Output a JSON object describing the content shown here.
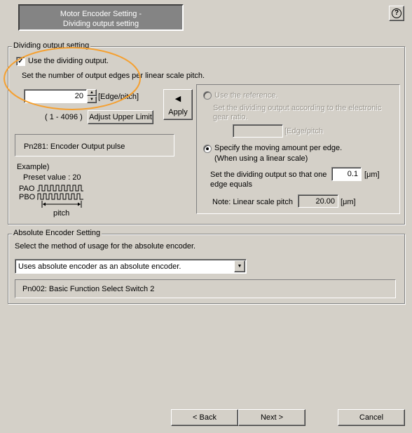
{
  "header": {
    "title_line1": "Motor Encoder Setting -",
    "title_line2": "Dividing output setting",
    "help_label": "?"
  },
  "dividing": {
    "group_label": "Dividing output setting",
    "use_checkbox_label": "Use the dividing output.",
    "use_checked": true,
    "instruction": "Set the number of output edges per linear scale pitch.",
    "edge_value": "20",
    "edge_unit": "[Edge/pitch]",
    "range": "( 1 - 4096 )",
    "adjust_button": "Adjust Upper Limit",
    "apply_button": "Apply",
    "param_label": "Pn281: Encoder Output pulse",
    "example_title": "Example)",
    "preset_value": "Preset value : 20",
    "pao_label": "PAO",
    "pbo_label": "PBO",
    "pitch_label": "pitch",
    "reference_radio_label": "Use the reference.",
    "reference_desc": "Set the dividing output according to the electronic gear ratio.",
    "reference_value": "",
    "reference_unit": "[Edge/pitch",
    "moving_radio_line1": "Specify the moving amount per edge.",
    "moving_radio_line2": "(When using a linear scale)",
    "edge_equals_label": "Set the dividing output so that one edge equals",
    "edge_equals_value": "0.1",
    "edge_equals_unit": "[μm]",
    "note_label": "Note: Linear scale pitch",
    "pitch_value": "20.00",
    "pitch_unit": "[μm]"
  },
  "absolute": {
    "group_label": "Absolute Encoder Setting",
    "instruction": "Select the method of usage for the absolute encoder.",
    "selected_option": "Uses absolute encoder as an absolute encoder.",
    "param_label": "Pn002: Basic Function Select Switch 2"
  },
  "footer": {
    "back_button": "< Back",
    "next_button": "Next >",
    "cancel_button": "Cancel"
  },
  "colors": {
    "window_bg": "#d4d0c8",
    "highlight_ellipse": "#f5a030"
  }
}
